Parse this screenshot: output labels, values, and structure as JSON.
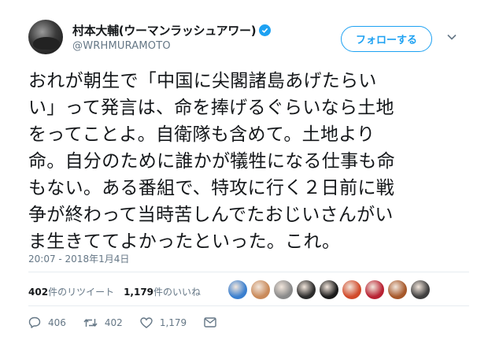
{
  "author": {
    "display_name": "村本大輔(ウーマンラッシュアワー)",
    "handle": "@WRHMURAMOTO",
    "verified": true
  },
  "follow_button": {
    "label": "フォローする"
  },
  "tweet": {
    "lines": [
      "おれが朝生で「中国に尖閣諸島あげたらい",
      "い」って発言は、命を捧げるぐらいなら土地",
      "をってことよ。自衛隊も含めて。土地より",
      "命。自分のために誰かが犠牲になる仕事も命",
      "もない。ある番組で、特攻に行く２日前に戦",
      "争が終わって当時苦しんでたおじいさんがい",
      "ま生きててよかったといった。これ。"
    ],
    "timestamp": "20:07 - 2018年1月4日"
  },
  "stats": {
    "retweets_count": "402",
    "retweets_label": "件のリツイート",
    "likes_count": "1,179",
    "likes_label": "件のいいね"
  },
  "liker_avatars": [
    {
      "icon": "face-avatar-1",
      "color": "#3a7fcf"
    },
    {
      "icon": "face-avatar-2",
      "color": "#c98a5a"
    },
    {
      "icon": "face-avatar-3",
      "color": "#8a8a8a"
    },
    {
      "icon": "face-avatar-4",
      "color": "#2b2b2b"
    },
    {
      "icon": "face-avatar-5",
      "color": "#1a1a1a"
    },
    {
      "icon": "face-avatar-6",
      "color": "#d14a2a"
    },
    {
      "icon": "face-avatar-7",
      "color": "#b82233"
    },
    {
      "icon": "face-avatar-8",
      "color": "#a6582a"
    },
    {
      "icon": "face-avatar-9",
      "color": "#3f3f3f"
    }
  ],
  "actions": {
    "reply_count": "406",
    "retweet_count": "402",
    "like_count": "1,179"
  },
  "colors": {
    "accent": "#1da1f2",
    "text": "#14171a",
    "muted": "#657786"
  }
}
